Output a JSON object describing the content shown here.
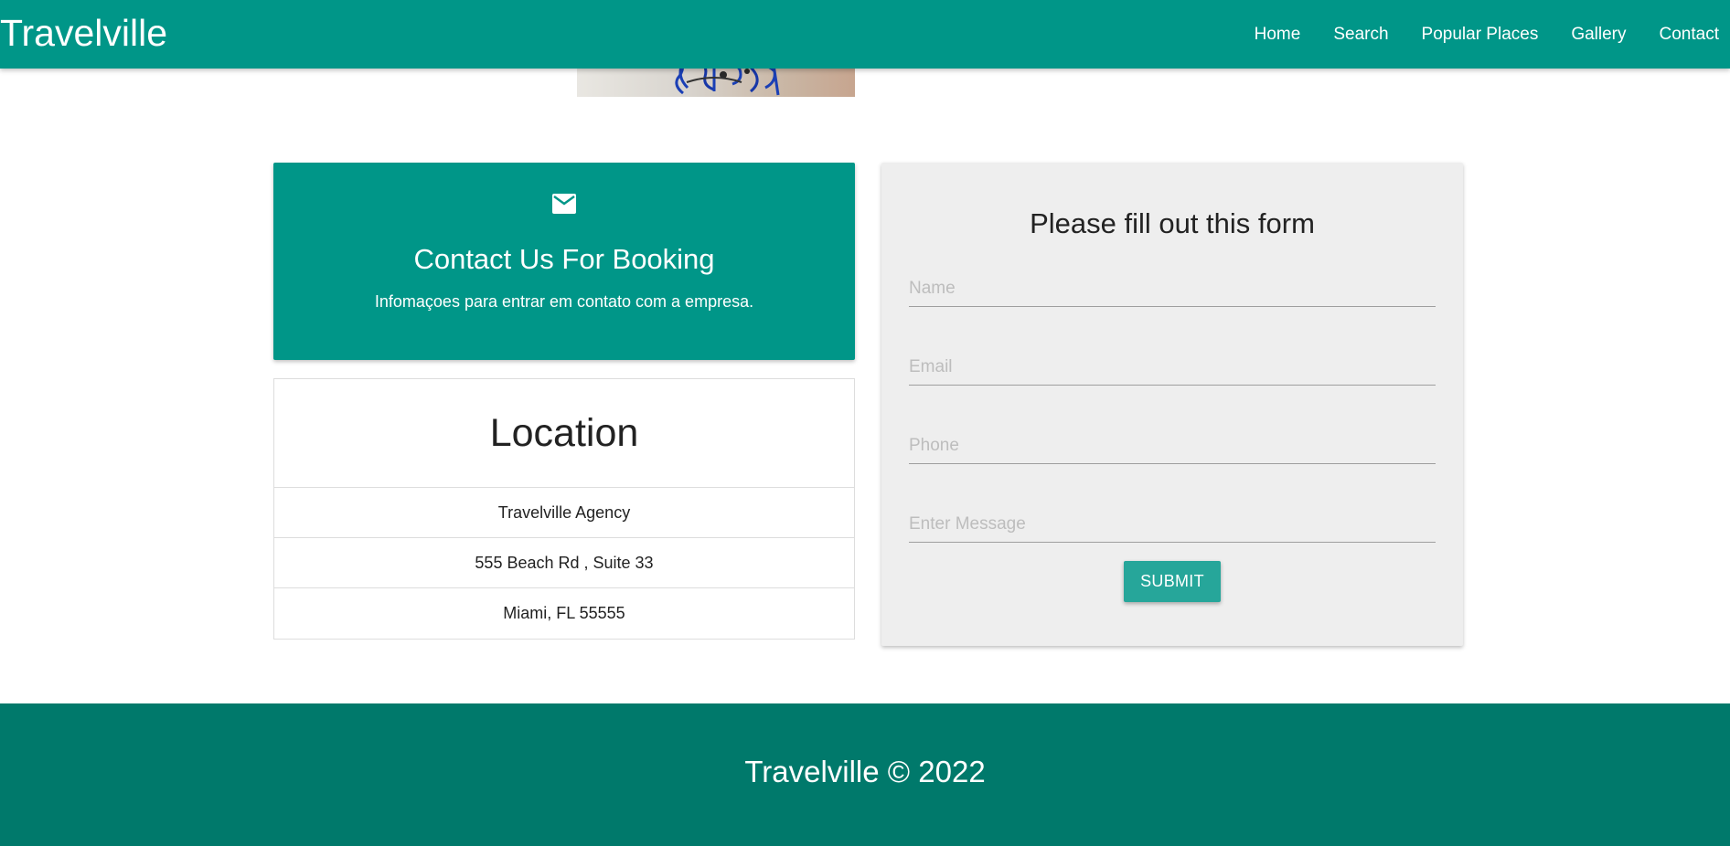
{
  "navbar": {
    "brand": "Travelville",
    "links": [
      "Home",
      "Search",
      "Popular Places",
      "Gallery",
      "Contact"
    ]
  },
  "contact_card": {
    "icon": "mail-icon",
    "title": "Contact Us For Booking",
    "subtitle": "Infomaçoes para entrar em contato com a empresa."
  },
  "location": {
    "title": "Location",
    "items": [
      "Travelville Agency",
      "555 Beach Rd , Suite 33",
      "Miami, FL 55555"
    ]
  },
  "form": {
    "title": "Please fill out this form",
    "name_placeholder": "Name",
    "email_placeholder": "Email",
    "phone_placeholder": "Phone",
    "message_placeholder": "Enter Message",
    "submit_label": "SUBMIT"
  },
  "footer": {
    "text": "Travelville © 2022"
  },
  "colors": {
    "primary": "#009688",
    "footer": "#00796b",
    "button": "#26a69a",
    "form_bg": "#eeeeee"
  }
}
